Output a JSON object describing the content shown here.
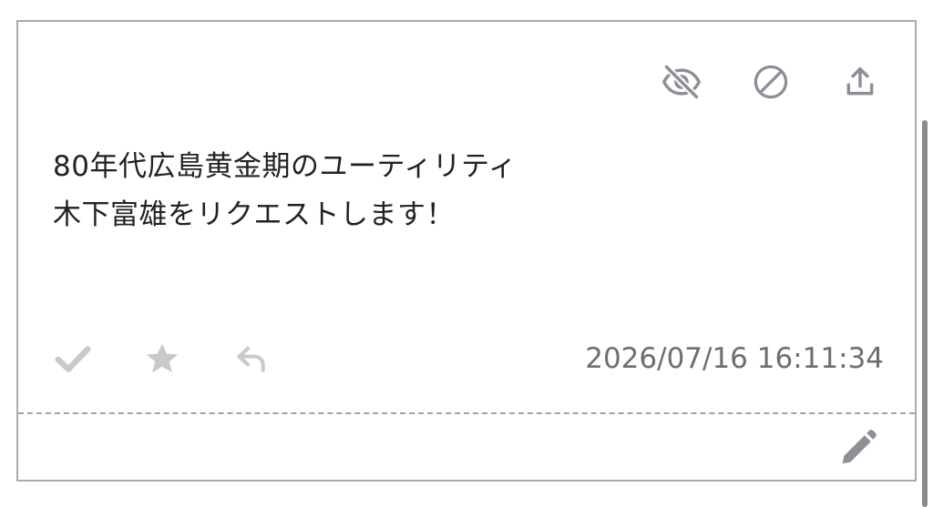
{
  "post": {
    "message_lines": [
      "80年代広島黄金期のユーティリティ",
      "木下富雄をリクエストします！"
    ],
    "timestamp": "2026/07/16 16:11:34"
  },
  "icons": {
    "hide": "eye-off-icon",
    "block": "block-icon",
    "share": "share-upload-icon",
    "check": "check-icon",
    "star": "star-icon",
    "reply": "reply-icon",
    "edit": "pencil-icon"
  },
  "colors": {
    "icon_dark": "#8e8e96",
    "icon_light": "#c9c9cc",
    "border": "#a9a9b3",
    "text": "#222222",
    "timestamp": "#6e6e6e"
  }
}
